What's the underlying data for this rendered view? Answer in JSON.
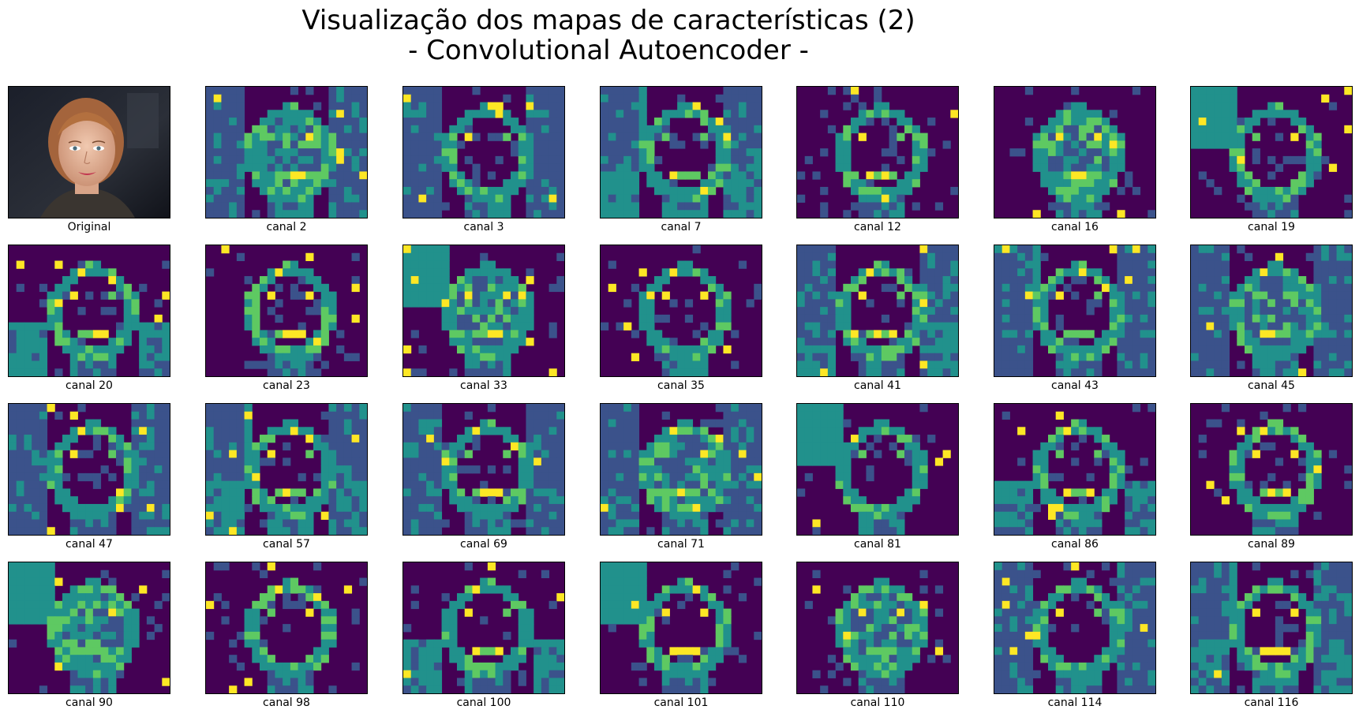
{
  "title": {
    "line1": "Visualização dos mapas de características (2)",
    "line2": "- Convolutional Autoencoder -"
  },
  "colormap": [
    "#440154",
    "#3b528b",
    "#21918c",
    "#5ec962",
    "#fde725"
  ],
  "panels": [
    {
      "label": "Original",
      "kind": "photo"
    },
    {
      "label": "canal 2",
      "kind": "map"
    },
    {
      "label": "canal 3",
      "kind": "map"
    },
    {
      "label": "canal 7",
      "kind": "map"
    },
    {
      "label": "canal 12",
      "kind": "map"
    },
    {
      "label": "canal 16",
      "kind": "map"
    },
    {
      "label": "canal 19",
      "kind": "map"
    },
    {
      "label": "canal 20",
      "kind": "map"
    },
    {
      "label": "canal 23",
      "kind": "map"
    },
    {
      "label": "canal 33",
      "kind": "map"
    },
    {
      "label": "canal 35",
      "kind": "map"
    },
    {
      "label": "canal 41",
      "kind": "map"
    },
    {
      "label": "canal 43",
      "kind": "map"
    },
    {
      "label": "canal 45",
      "kind": "map"
    },
    {
      "label": "canal 47",
      "kind": "map"
    },
    {
      "label": "canal 57",
      "kind": "map"
    },
    {
      "label": "canal 69",
      "kind": "map"
    },
    {
      "label": "canal 71",
      "kind": "map"
    },
    {
      "label": "canal 81",
      "kind": "map"
    },
    {
      "label": "canal 86",
      "kind": "map"
    },
    {
      "label": "canal 89",
      "kind": "map"
    },
    {
      "label": "canal 90",
      "kind": "map"
    },
    {
      "label": "canal 98",
      "kind": "map"
    },
    {
      "label": "canal 100",
      "kind": "map"
    },
    {
      "label": "canal 101",
      "kind": "map"
    },
    {
      "label": "canal 110",
      "kind": "map"
    },
    {
      "label": "canal 114",
      "kind": "map"
    },
    {
      "label": "canal 116",
      "kind": "map"
    }
  ]
}
